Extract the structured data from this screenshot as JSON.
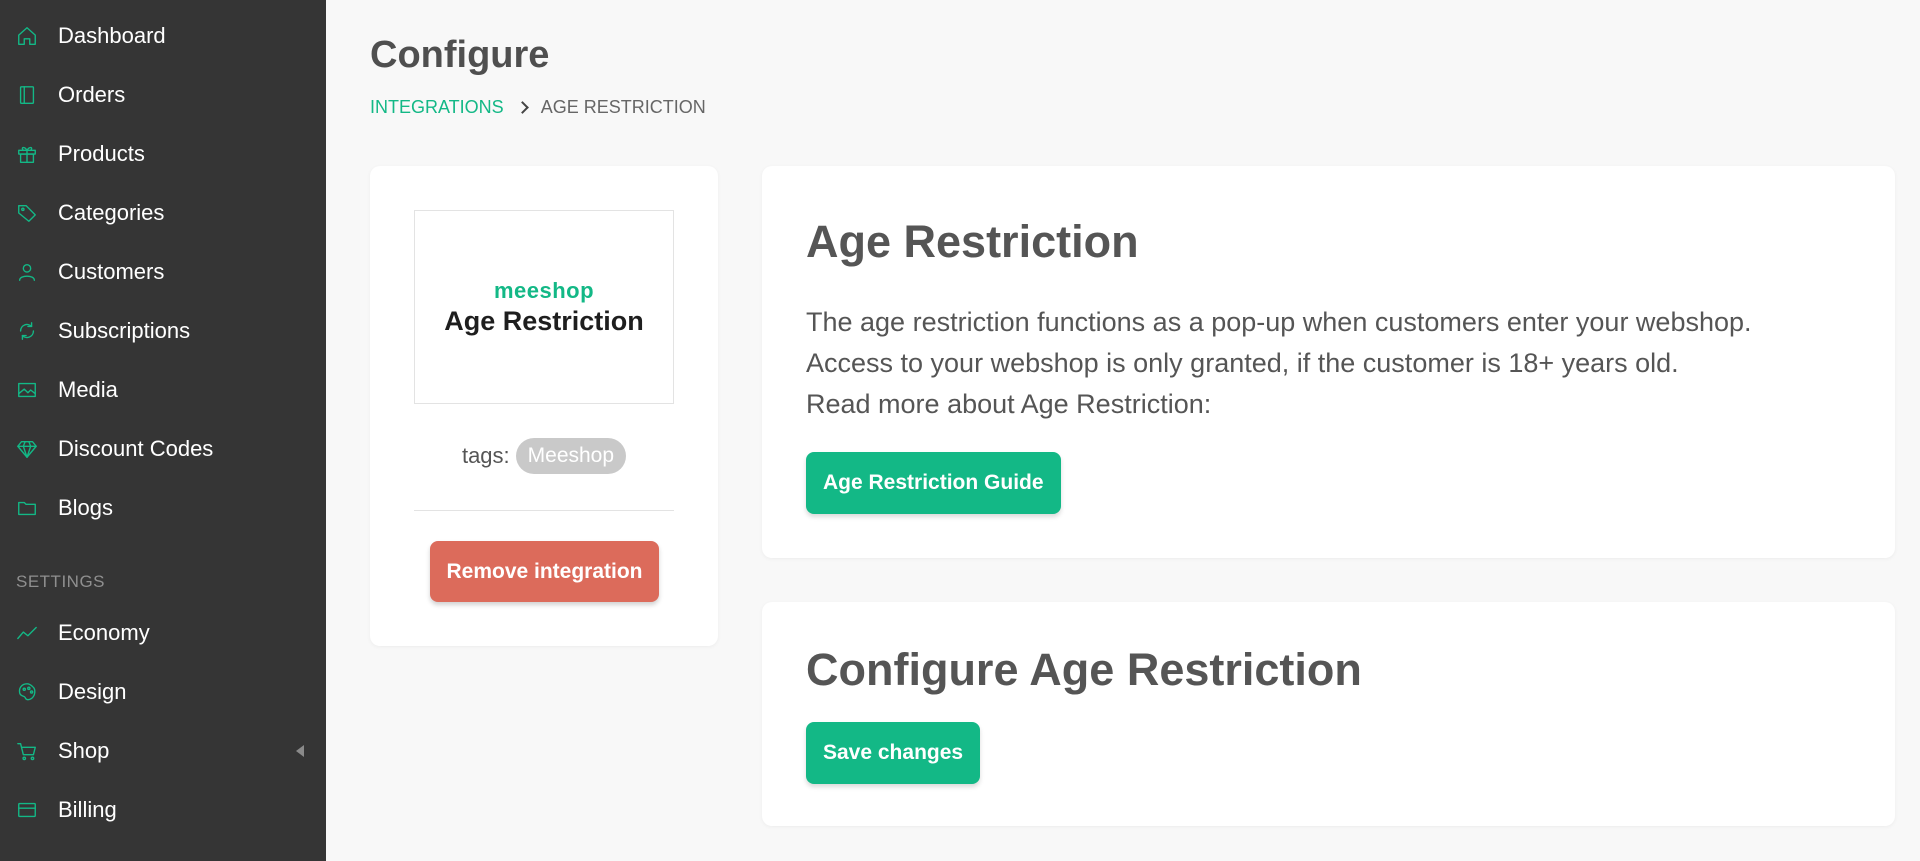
{
  "sidebar": {
    "items": [
      {
        "label": "Dashboard",
        "icon": "home-icon"
      },
      {
        "label": "Orders",
        "icon": "book-icon"
      },
      {
        "label": "Products",
        "icon": "gift-icon"
      },
      {
        "label": "Categories",
        "icon": "tag-icon"
      },
      {
        "label": "Customers",
        "icon": "user-icon"
      },
      {
        "label": "Subscriptions",
        "icon": "refresh-icon"
      },
      {
        "label": "Media",
        "icon": "image-icon"
      },
      {
        "label": "Discount Codes",
        "icon": "diamond-icon"
      },
      {
        "label": "Blogs",
        "icon": "folder-icon"
      }
    ],
    "settings_label": "SETTINGS",
    "settings_items": [
      {
        "label": "Economy",
        "icon": "trend-icon"
      },
      {
        "label": "Design",
        "icon": "palette-icon"
      },
      {
        "label": "Shop",
        "icon": "cart-icon"
      },
      {
        "label": "Billing",
        "icon": "credit-card-icon"
      }
    ]
  },
  "page": {
    "title": "Configure",
    "breadcrumb": {
      "parent": "INTEGRATIONS",
      "current": "AGE RESTRICTION"
    }
  },
  "integration": {
    "logo_brand": "meeshop",
    "logo_title": "Age Restriction",
    "tags_label": "tags:",
    "tag": "Meeshop",
    "remove_label": "Remove integration"
  },
  "info": {
    "heading": "Age Restriction",
    "lines": [
      "The age restriction functions as a pop-up when customers enter your webshop.",
      "Access to your webshop is only granted, if the customer is 18+ years old.",
      "Read more about Age Restriction:"
    ],
    "guide_label": "Age Restriction Guide"
  },
  "config": {
    "heading": "Configure Age Restriction",
    "save_label": "Save changes"
  },
  "colors": {
    "accent": "#13b886",
    "sidebar_bg": "#353535",
    "danger": "#dc6b5b",
    "page_bg": "#f8f8f8"
  }
}
